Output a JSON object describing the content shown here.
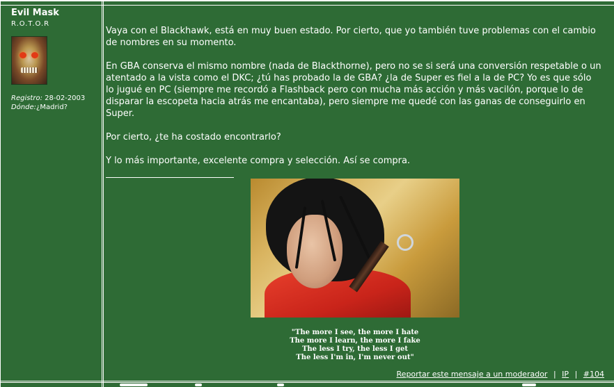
{
  "post": {
    "author": {
      "name": "Evil Mask",
      "rank": "R.O.T.O.R",
      "avatar_icon": "skull-avatar",
      "registered_label": "Registro:",
      "registered_value": " 28-02-2003",
      "location_label": "Dónde:",
      "location_value": "¿Madrid?"
    },
    "body": [
      "Vaya con el Blackhawk, está en muy buen estado. Por cierto, que yo también tuve problemas con el cambio de nombres en su momento.",
      "En GBA conserva el mismo nombre (nada de Blackthorne), pero no se si será una conversión respetable o un atentado a la vista como el DKC; ¿tú has probado la de GBA? ¿la de Super es fiel a la de PC? Yo es que sólo lo jugué en PC (siempre me recordó a Flashback pero con mucha más acción y más vacilón, porque lo de disparar la escopeta hacia atrás me encantaba), pero siempre me quedé con las ganas de conseguirlo en Super.",
      "Por cierto, ¿te ha costado encontrarlo?",
      "Y lo más importante, excelente compra y selección. Así se compra."
    ],
    "signature": {
      "image_icon": "woman-with-sword-photo",
      "quote_lines": [
        "\"The more I see, the more I hate",
        "The more I learn, the more I fake",
        "The less I try, the less I get",
        "The less I'm in, I'm never out\""
      ]
    },
    "actions": {
      "report": "Reportar este mensaje a un moderador",
      "separator": "|",
      "ip": "IP",
      "permalink": "#104"
    }
  },
  "colors": {
    "background": "#2e6b35",
    "text": "#ffffff",
    "border": "#ffffff"
  }
}
